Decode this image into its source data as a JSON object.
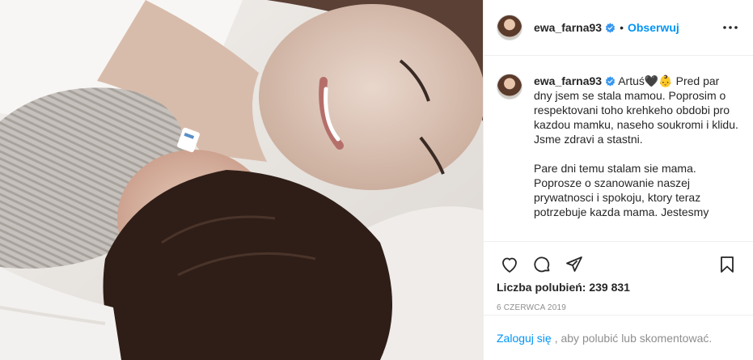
{
  "photo": {
    "alt_subject": "mother and newborn"
  },
  "author": {
    "username": "ewa_farna93",
    "verified": true
  },
  "header": {
    "separator": "•",
    "follow_label": "Obserwuj",
    "more_icon": "more-dots-icon"
  },
  "caption": {
    "username": "ewa_farna93",
    "text": "Artuś🖤👶 Pred par dny jsem se stala mamou. Poprosim o respektovani toho krehkeho obdobi pro kazdou mamku, naseho soukromi i klidu.\nJsme zdravi a stastni.\n\nPare dni temu stalam sie mama. Poprosze o szanowanie naszej prywatnosci i spokoju, ktory teraz potrzebuje kazda mama. Jestesmy"
  },
  "actions": {
    "like_icon": "heart-icon",
    "comment_icon": "comment-icon",
    "share_icon": "share-icon",
    "save_icon": "bookmark-icon"
  },
  "likes": {
    "text": "Liczba polubień: 239 831"
  },
  "date": {
    "text": "6 CZERWCA 2019"
  },
  "login": {
    "link_label": "Zaloguj się",
    "rest_text": ", aby polubić lub skomentować."
  },
  "colors": {
    "link": "#0095f6",
    "text": "#262626",
    "muted": "#8e8e8e",
    "border": "#efefef"
  }
}
